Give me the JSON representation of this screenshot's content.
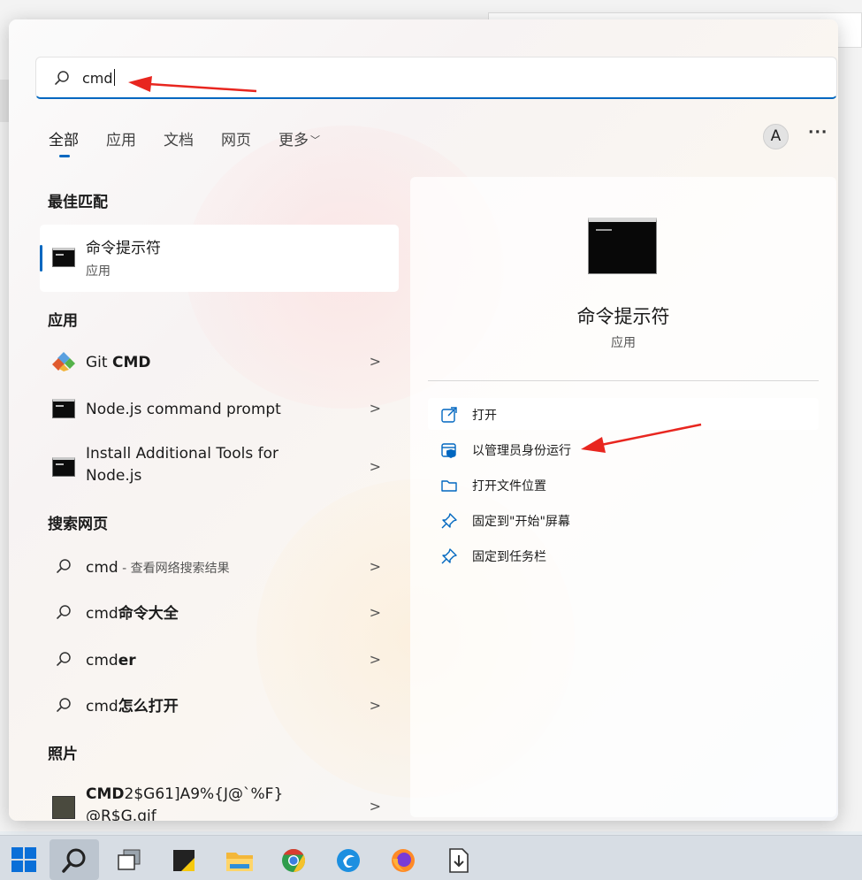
{
  "search": {
    "value": "cmd"
  },
  "tabs": [
    {
      "label": "全部",
      "active": true
    },
    {
      "label": "应用",
      "active": false
    },
    {
      "label": "文档",
      "active": false
    },
    {
      "label": "网页",
      "active": false
    },
    {
      "label": "更多",
      "active": false
    }
  ],
  "account": {
    "initial": "A",
    "more": "···"
  },
  "sections": {
    "best_match": "最佳匹配",
    "apps": "应用",
    "web": "搜索网页",
    "photos": "照片"
  },
  "best_match": {
    "title": "命令提示符",
    "type": "应用"
  },
  "apps": [
    {
      "plain": "Git ",
      "bold": "CMD"
    },
    {
      "plain": "Node.js command prompt",
      "bold": ""
    },
    {
      "plain": "Install Additional Tools for",
      "line2": "Node.js"
    }
  ],
  "web": [
    {
      "plain": "cmd",
      "bold": "",
      "sub": " - 查看网络搜索结果"
    },
    {
      "plain": "cmd",
      "bold": "命令大全",
      "sub": ""
    },
    {
      "plain": "cmd",
      "bold": "er",
      "sub": ""
    },
    {
      "plain": "cmd",
      "bold": "怎么打开",
      "sub": ""
    }
  ],
  "photos": [
    {
      "bold": "CMD",
      "plain": "2$G61]A9%{J@`%F}",
      "line2": "@R$G.gif"
    }
  ],
  "detail": {
    "title": "命令提示符",
    "type": "应用",
    "actions": [
      {
        "label": "打开",
        "icon": "open-external-icon"
      },
      {
        "label": "以管理员身份运行",
        "icon": "shield-admin-icon"
      },
      {
        "label": "打开文件位置",
        "icon": "folder-icon"
      },
      {
        "label": "固定到\"开始\"屏幕",
        "icon": "pin-icon"
      },
      {
        "label": "固定到任务栏",
        "icon": "pin-icon"
      }
    ]
  },
  "colors": {
    "accent": "#0067c0",
    "annotation": "#e8261f"
  },
  "taskbar": [
    "windows-start-icon",
    "search-icon",
    "task-view-icon",
    "sticky-notes-icon",
    "file-explorer-icon",
    "chrome-icon",
    "browser-icon",
    "firefox-icon",
    "download-app-icon"
  ]
}
